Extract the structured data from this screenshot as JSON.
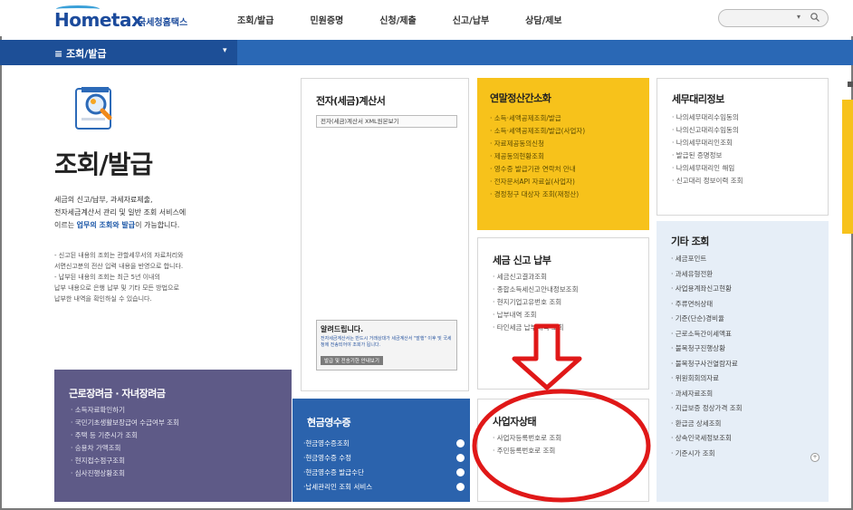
{
  "header": {
    "logo": {
      "main": "Hometax",
      "sub": "국세청홈택스"
    },
    "nav": [
      "조회/발급",
      "민원증명",
      "신청/제출",
      "신고/납부",
      "상담/제보"
    ],
    "search": {
      "placeholder": ""
    }
  },
  "subbar": {
    "label": "≡  조회/발급"
  },
  "intro": {
    "title": "조회/발급",
    "desc_1": "세금의 신고/납부, 과세자료제출,",
    "desc_2": "전자세금계산서 관리 및 일반 조회 서비스에",
    "desc_3_pre": "이르는 ",
    "desc_3_hl": "업무의 조회와 발급",
    "desc_3_post": "이 가능합니다.",
    "notes": [
      "- 신고된 내용의 조회는 관할세무서의 자료처리와",
      "  서면신고분의 전산 입력 내용을 반영으로 합니다.",
      "- 납부된 내용의 조회는 최근 5년 이내의",
      "  납부 내용으로 은행 납부 및 기타 모든 방법으로",
      "  납부한 내역을 확인하실 수 있습니다."
    ]
  },
  "boxes": {
    "tax_invoice": {
      "title": "전자(세금)계산서",
      "xml_button": "전자(세금)계산서 XML원본보기",
      "notice_title": "알려드립니다.",
      "notice_text": "전자세금계산서는 반드시 거래상대가 세금계산서 \"발행\" 이후 및 국세청에 전송되어야 조회가 됩니다.",
      "notice_button": "발급 및 전송기한 안내보기"
    },
    "year_end": {
      "title": "연말정산간소화",
      "items": [
        "· 소득·세액공제조회/발급",
        "· 소득·세액공제조회/발급(사업자)",
        "· 자료제공동의신청",
        "· 제공동의현황조회",
        "· 영수증 발급기관 연락처 안내",
        "· 전자문서API 자료실(사업자)",
        "· 경정청구 대상자 조회(재정산)"
      ]
    },
    "agent": {
      "title": "세무대리정보",
      "items": [
        "· 나의세무대리수임동의",
        "· 나의신고대리수임동의",
        "· 나의세무대리인조회",
        "· 발급된 증명정보",
        "· 나의세무대리인 해임",
        "· 신고대리 정보이력 조회"
      ]
    },
    "report": {
      "title": "세금 신고 납부",
      "items": [
        "· 세금신고결과조회",
        "· 종합소득세신고안내정보조회",
        "· 현지기업고유번호 조회",
        "· 납부내역 조회",
        "· 타인세금 납부내역 조회"
      ]
    },
    "business": {
      "title": "사업자상태",
      "items": [
        "· 사업자등록번호로 조회",
        "· 주민등록번호로 조회"
      ]
    },
    "etc": {
      "title": "기타 조회",
      "items": [
        "· 세금포인트",
        "· 과세유형전환",
        "· 사업용계좌신고현황",
        "· 주류면허상태",
        "· 기준(단순)경비율",
        "· 근로소득간이세액표",
        "· 불복청구진행상황",
        "· 불복청구사건열람자료",
        "· 위원회회의자료",
        "· 과세자료조회",
        "· 지급보증 정상가격 조회",
        "· 환급금 상세조회",
        "· 상속인국세정보조회",
        "· 기준시가 조회"
      ],
      "more": "+"
    },
    "earned_income": {
      "title": "근로장려금 · 자녀장려금",
      "items": [
        "· 소득자료확인하기",
        "· 국민기초생활보장급여 수급여부 조회",
        "· 주택 등 기준시가 조회",
        "· 승용차 가액조회",
        "· 현지접수점구조회",
        "· 심사진행상황조회"
      ]
    },
    "cash_receipt": {
      "title": "현금영수증",
      "items": [
        "·현금영수증조회",
        "·현금영수증 수정",
        "·현금영수증 발급수단",
        "·납세관리인 조회 서비스"
      ]
    }
  },
  "colors": {
    "nav_blue": "#2a68b5",
    "yellow": "#f7c21b",
    "purple": "#5e5a87",
    "cash_blue": "#2b63ad",
    "annotation_red": "#e01818"
  }
}
